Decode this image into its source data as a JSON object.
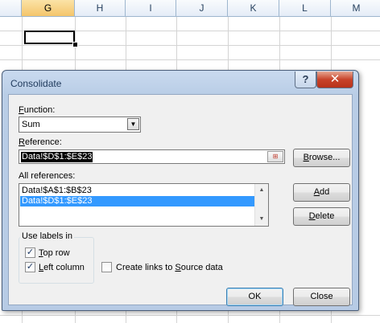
{
  "sheet": {
    "columns": [
      "G",
      "H",
      "I",
      "J",
      "K",
      "L",
      "M"
    ],
    "selected_column": "G"
  },
  "dialog": {
    "title": "Consolidate",
    "help_glyph": "?",
    "close_glyph": "✕",
    "function": {
      "label_accel": "F",
      "label_rest": "unction:",
      "value": "Sum",
      "arrow": "▼"
    },
    "reference": {
      "label_accel": "R",
      "label_rest": "eference:",
      "value": "Data!$D$1:$E$23",
      "refedit_glyph": "⊞"
    },
    "browse_button": {
      "accel": "B",
      "rest": "rowse..."
    },
    "all_references": {
      "label": "All references:",
      "items": [
        "Data!$A$1:$B$23",
        "Data!$D$1:$E$23"
      ],
      "selected_index": 1,
      "scroll_up": "▲",
      "scroll_down": "▼"
    },
    "add_button": {
      "accel": "A",
      "rest": "dd"
    },
    "delete_button": {
      "accel": "D",
      "rest": "elete"
    },
    "use_labels": {
      "label": "Use labels in",
      "top_row": {
        "accel": "T",
        "rest": "op row",
        "checked": true
      },
      "left_column": {
        "accel": "L",
        "rest": "eft column",
        "checked": true
      }
    },
    "create_links": {
      "accel": "S",
      "before": "Create links to ",
      "after": "ource data",
      "checked": false
    },
    "ok_button": "OK",
    "close_button": "Close",
    "check_glyph": "✓"
  }
}
